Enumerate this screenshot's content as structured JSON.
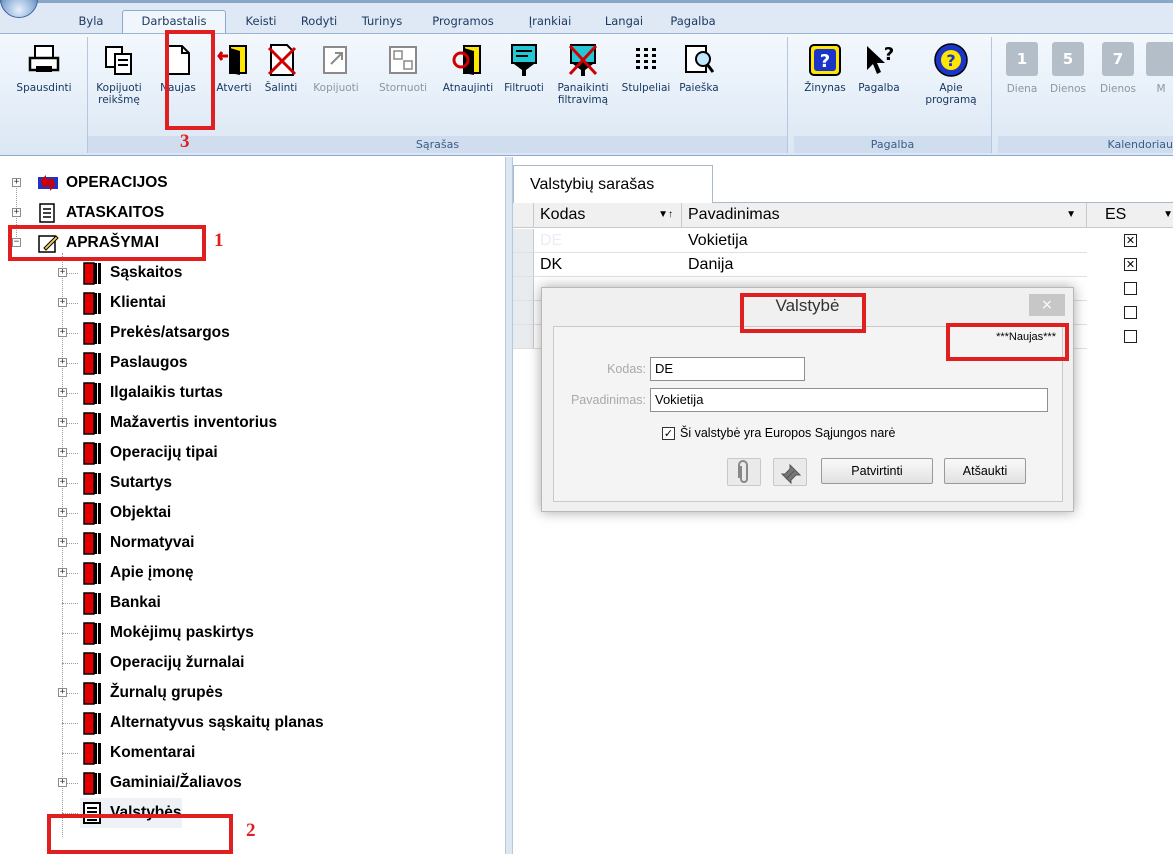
{
  "menu": {
    "tabs": [
      "Byla",
      "Darbastalis",
      "Keisti",
      "Rodyti",
      "Turinys",
      "Programos",
      "Įrankiai",
      "Langai",
      "Pagalba"
    ]
  },
  "ribbon": {
    "groups": {
      "list": "Sąrašas",
      "help": "Pagalba",
      "calendar": "Kalendoriau"
    },
    "buttons": {
      "print": "Spausdinti",
      "copy_value": "Kopijuoti\nreikšmę",
      "new": "Naujas",
      "open": "Atverti",
      "delete": "Šalinti",
      "copy": "Kopijuoti",
      "cancel": "Stornuoti",
      "refresh": "Atnaujinti",
      "filter": "Filtruoti",
      "clear_filter": "Panaikinti\nfiltravimą",
      "columns": "Stulpeliai",
      "search": "Paieška",
      "guide": "Žinynas",
      "help": "Pagalba",
      "about": "Apie\nprogramą"
    },
    "calendar": [
      {
        "num": "1",
        "label": "Diena"
      },
      {
        "num": "5",
        "label": "Dienos"
      },
      {
        "num": "7",
        "label": "Dienos"
      },
      {
        "num": "",
        "label": "M"
      }
    ]
  },
  "tree": {
    "roots": [
      "OPERACIJOS",
      "ATASKAITOS",
      "APRAŠYMAI"
    ],
    "children": [
      "Sąskaitos",
      "Klientai",
      "Prekės/atsargos",
      "Paslaugos",
      "Ilgalaikis turtas",
      "Mažavertis inventorius",
      "Operacijų tipai",
      "Sutartys",
      "Objektai",
      "Normatyvai",
      "Apie įmonę",
      "Bankai",
      "Mokėjimų paskirtys",
      "Operacijų žurnalai",
      "Žurnalų grupės",
      "Alternatyvus sąskaitų planas",
      "Komentarai",
      "Gaminiai/Žaliavos",
      "Valstybės"
    ]
  },
  "panel": {
    "tab": "Valstybių sarašas",
    "columns": {
      "code": "Kodas",
      "name": "Pavadinimas",
      "es": "ES"
    },
    "rows": [
      {
        "code": "DE",
        "name": "Vokietija",
        "es": true
      },
      {
        "code": "DK",
        "name": "Danija",
        "es": true
      },
      {
        "code": "",
        "name": "",
        "es": false
      },
      {
        "code": "",
        "name": "",
        "es": false
      },
      {
        "code": "",
        "name": "",
        "es": false
      }
    ]
  },
  "dialog": {
    "title": "Valstybė",
    "close": "×",
    "status": "***Naujas***",
    "code_label": "Kodas:",
    "code_value": "DE",
    "name_label": "Pavadinimas:",
    "name_value": "Vokietija",
    "eu_label": "Ši valstybė yra Europos Sąjungos narė",
    "eu_checked": true,
    "confirm": "Patvirtinti",
    "cancel": "Atšaukti"
  },
  "annotations": {
    "step1": "1",
    "step2": "2",
    "step3": "3"
  },
  "colors": {
    "annotation": "#e02020",
    "ribbon_text": "#15365f",
    "help_blue": "#1a35c8"
  }
}
